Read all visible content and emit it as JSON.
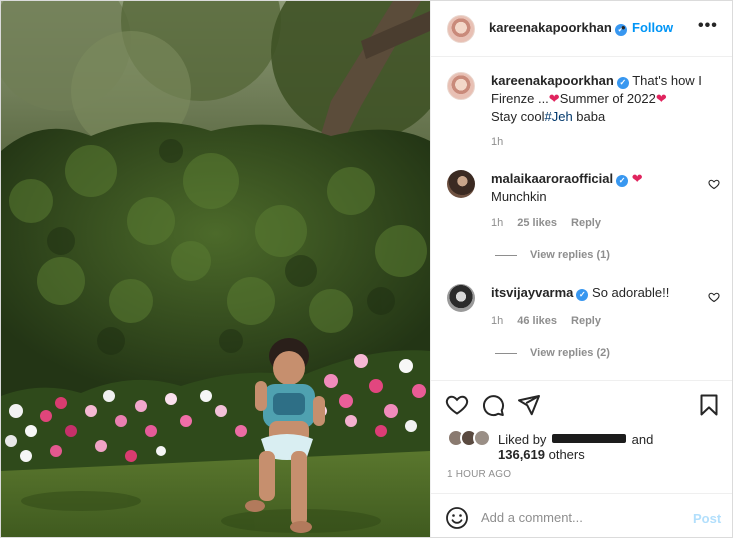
{
  "post": {
    "author": "kareenakapoorkhan",
    "author_verified": true,
    "follow_label": "Follow",
    "dot": "•",
    "more_label": "•••",
    "caption_line1": "That's how I",
    "caption_line2a": "Firenze ...",
    "caption_line2b": "Summer of 2022",
    "caption_line3a": "Stay cool",
    "caption_hashtag": "#Jeh",
    "caption_line3b": " baba",
    "caption_time": "1h",
    "heart_glyph": "❤"
  },
  "comments": [
    {
      "username": "malaikaaroraofficial",
      "verified": true,
      "text": "Munchkin",
      "time": "1h",
      "likes": "25 likes",
      "reply_label": "Reply",
      "view_replies": "View replies (1)"
    },
    {
      "username": "itsvijayvarma",
      "verified": true,
      "text": "So adorable!!",
      "time": "1h",
      "likes": "46 likes",
      "reply_label": "Reply",
      "view_replies": "View replies (2)"
    }
  ],
  "engagement": {
    "liked_by_prefix": "Liked by",
    "liked_by_suffix": "and",
    "others_count": "136,619",
    "others_label": " others",
    "time_ago": "1 HOUR AGO"
  },
  "composer": {
    "placeholder": "Add a comment...",
    "post_label": "Post"
  },
  "icons": {
    "verified": "verified-badge-icon",
    "like": "heart-outline-icon",
    "comment": "speech-bubble-icon",
    "share": "paper-plane-icon",
    "save": "bookmark-icon",
    "emoji": "smiley-icon"
  },
  "colors": {
    "link_blue": "#0095f6",
    "verified_blue": "#3897f0",
    "heart_red": "#e0245e",
    "muted": "#8e8e8e",
    "post_disabled": "#b2dffc"
  }
}
